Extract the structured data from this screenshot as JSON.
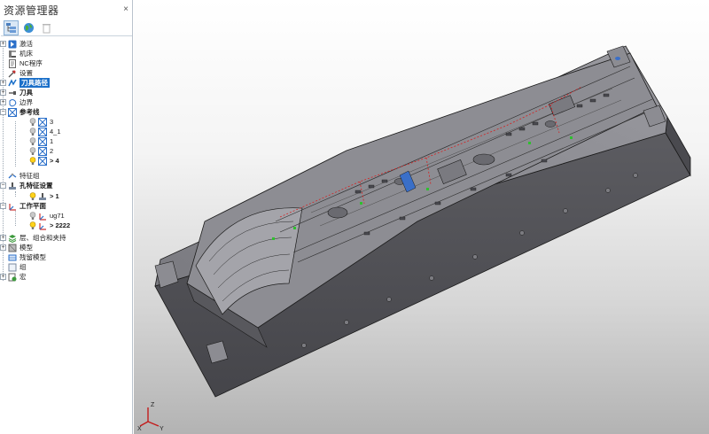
{
  "explorer": {
    "title": "资源管理器",
    "close_glyph": "×",
    "toolbar": [
      {
        "icon": "explorer-tree-icon",
        "active": true
      },
      {
        "icon": "globe-icon",
        "active": false
      },
      {
        "icon": "trash-icon",
        "active": false
      }
    ],
    "tree": [
      {
        "label": "激活",
        "icon": "activate-icon",
        "expander": "+",
        "level": 0
      },
      {
        "label": "机床",
        "icon": "machine-icon",
        "expander": "",
        "level": 0
      },
      {
        "label": "NC程序",
        "icon": "nc-program-icon",
        "expander": "",
        "level": 0
      },
      {
        "label": "设置",
        "icon": "setup-icon",
        "expander": "",
        "level": 0
      },
      {
        "label": "刀具路径",
        "icon": "toolpath-icon",
        "expander": "+",
        "level": 0,
        "highlight": true,
        "bold": true
      },
      {
        "label": "刀具",
        "icon": "tool-icon",
        "expander": "+",
        "level": 0,
        "bold": true
      },
      {
        "label": "边界",
        "icon": "boundary-icon",
        "expander": "+",
        "level": 0
      },
      {
        "label": "参考线",
        "icon": "pattern-icon",
        "expander": "−",
        "level": 0,
        "bold": true
      },
      {
        "label": "3",
        "icon": "pattern-icon",
        "expander": "",
        "level": 1,
        "bulb": "grey"
      },
      {
        "label": "4_1",
        "icon": "pattern-icon",
        "expander": "",
        "level": 1,
        "bulb": "grey"
      },
      {
        "label": "1",
        "icon": "pattern-icon",
        "expander": "",
        "level": 1,
        "bulb": "grey"
      },
      {
        "label": "2",
        "icon": "pattern-icon",
        "expander": "",
        "level": 1,
        "bulb": "grey"
      },
      {
        "label": "> 4",
        "icon": "pattern-icon",
        "expander": "",
        "level": 1,
        "bulb": "yellow",
        "bold": true
      },
      {
        "label": "特征组",
        "icon": "feature-group-icon",
        "expander": "",
        "level": 0
      },
      {
        "label": "孔特征设置",
        "icon": "hole-feature-icon",
        "expander": "−",
        "level": 0,
        "bold": true
      },
      {
        "label": "> 1",
        "icon": "hole-feature-icon",
        "expander": "",
        "level": 1,
        "bulb": "yellow",
        "bold": true
      },
      {
        "label": "工作平面",
        "icon": "workplane-icon",
        "expander": "−",
        "level": 0,
        "bold": true
      },
      {
        "label": "ug71",
        "icon": "workplane-icon",
        "expander": "",
        "level": 1,
        "bulb": "grey"
      },
      {
        "label": "> 2222",
        "icon": "workplane-icon",
        "expander": "",
        "level": 1,
        "bulb": "yellow",
        "bold": true
      },
      {
        "label": "层、组合和夹持",
        "icon": "layers-icon",
        "expander": "+",
        "level": 0
      },
      {
        "label": "模型",
        "icon": "model-icon",
        "expander": "+",
        "level": 0
      },
      {
        "label": "残留模型",
        "icon": "stock-model-icon",
        "expander": "",
        "level": 0
      },
      {
        "label": "组",
        "icon": "group-icon",
        "expander": "",
        "level": 0
      },
      {
        "label": "宏",
        "icon": "macro-icon",
        "expander": "+",
        "level": 0
      }
    ]
  },
  "viewport": {
    "triad": {
      "z": "Z",
      "x": "X",
      "y": "Y"
    },
    "colors": {
      "model": "#5e5e63",
      "edge": "#1a1a1a",
      "toolpath": "#d62020",
      "marker": "#2fbf2f",
      "blue_face": "#3a6fc8"
    }
  }
}
